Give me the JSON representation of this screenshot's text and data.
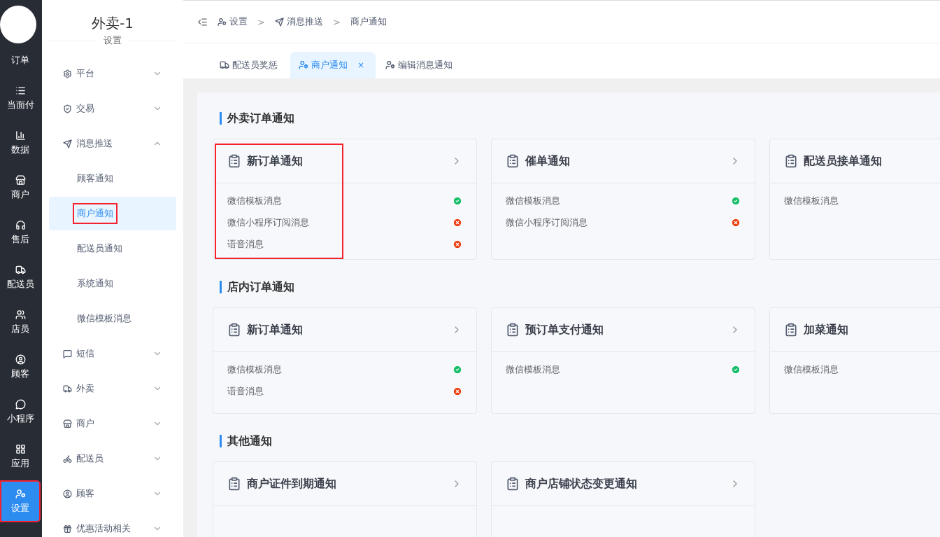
{
  "rail": {
    "items": [
      {
        "label": "订单",
        "selected": false,
        "annotated": false
      },
      {
        "label": "当面付",
        "selected": false,
        "annotated": false
      },
      {
        "label": "数据",
        "selected": false,
        "annotated": false
      },
      {
        "label": "商户",
        "selected": false,
        "annotated": false
      },
      {
        "label": "售后",
        "selected": false,
        "annotated": false
      },
      {
        "label": "配送员",
        "selected": false,
        "annotated": false
      },
      {
        "label": "店员",
        "selected": false,
        "annotated": false
      },
      {
        "label": "顾客",
        "selected": false,
        "annotated": false
      },
      {
        "label": "小程序",
        "selected": false,
        "annotated": false
      },
      {
        "label": "应用",
        "selected": false,
        "annotated": false
      },
      {
        "label": "设置",
        "selected": true,
        "annotated": true
      }
    ]
  },
  "submenu": {
    "title": "外卖-1",
    "subtitle": "设置",
    "items": [
      {
        "label": "平台",
        "expanded": false
      },
      {
        "label": "交易",
        "expanded": false
      },
      {
        "label": "消息推送",
        "expanded": true,
        "children": [
          {
            "label": "顾客通知",
            "selected": false,
            "annotated": false
          },
          {
            "label": "商户通知",
            "selected": true,
            "annotated": true
          },
          {
            "label": "配送员通知",
            "selected": false,
            "annotated": false
          },
          {
            "label": "系统通知",
            "selected": false,
            "annotated": false
          },
          {
            "label": "微信模板消息",
            "selected": false,
            "annotated": false
          }
        ]
      },
      {
        "label": "短信",
        "expanded": false
      },
      {
        "label": "外卖",
        "expanded": false
      },
      {
        "label": "商户",
        "expanded": false
      },
      {
        "label": "配送员",
        "expanded": false
      },
      {
        "label": "顾客",
        "expanded": false
      },
      {
        "label": "优惠活动相关",
        "expanded": false
      }
    ]
  },
  "breadcrumb": {
    "separator": ">",
    "items": [
      {
        "label": "设置"
      },
      {
        "label": "消息推送"
      },
      {
        "label": "商户通知"
      }
    ]
  },
  "tabs": [
    {
      "label": "配送员奖惩",
      "selected": false
    },
    {
      "label": "商户通知",
      "selected": true,
      "close": "×"
    },
    {
      "label": "编辑消息通知",
      "selected": false
    }
  ],
  "sections": [
    {
      "title": "外卖订单通知",
      "cards": [
        {
          "title": "新订单通知",
          "chevron": true,
          "annotated": true,
          "channels": [
            {
              "label": "微信模板消息",
              "enabled": true
            },
            {
              "label": "微信小程序订阅消息",
              "enabled": false
            },
            {
              "label": "语音消息",
              "enabled": false
            }
          ]
        },
        {
          "title": "催单通知",
          "chevron": true,
          "annotated": false,
          "channels": [
            {
              "label": "微信模板消息",
              "enabled": true
            },
            {
              "label": "微信小程序订阅消息",
              "enabled": false
            }
          ]
        },
        {
          "title": "配送员接单通知",
          "chevron": false,
          "annotated": false,
          "channels": [
            {
              "label": "微信模板消息"
            }
          ]
        }
      ]
    },
    {
      "title": "店内订单通知",
      "cards": [
        {
          "title": "新订单通知",
          "chevron": true,
          "annotated": false,
          "channels": [
            {
              "label": "微信模板消息",
              "enabled": true
            },
            {
              "label": "语音消息",
              "enabled": false
            }
          ]
        },
        {
          "title": "预订单支付通知",
          "chevron": true,
          "annotated": false,
          "channels": [
            {
              "label": "微信模板消息",
              "enabled": true
            }
          ]
        },
        {
          "title": "加菜通知",
          "chevron": false,
          "annotated": false,
          "channels": [
            {
              "label": "微信模板消息"
            }
          ]
        }
      ]
    },
    {
      "title": "其他通知",
      "cards": [
        {
          "title": "商户证件到期通知",
          "chevron": true,
          "annotated": false
        },
        {
          "title": "商户店铺状态变更通知",
          "chevron": true,
          "annotated": false
        }
      ]
    }
  ]
}
